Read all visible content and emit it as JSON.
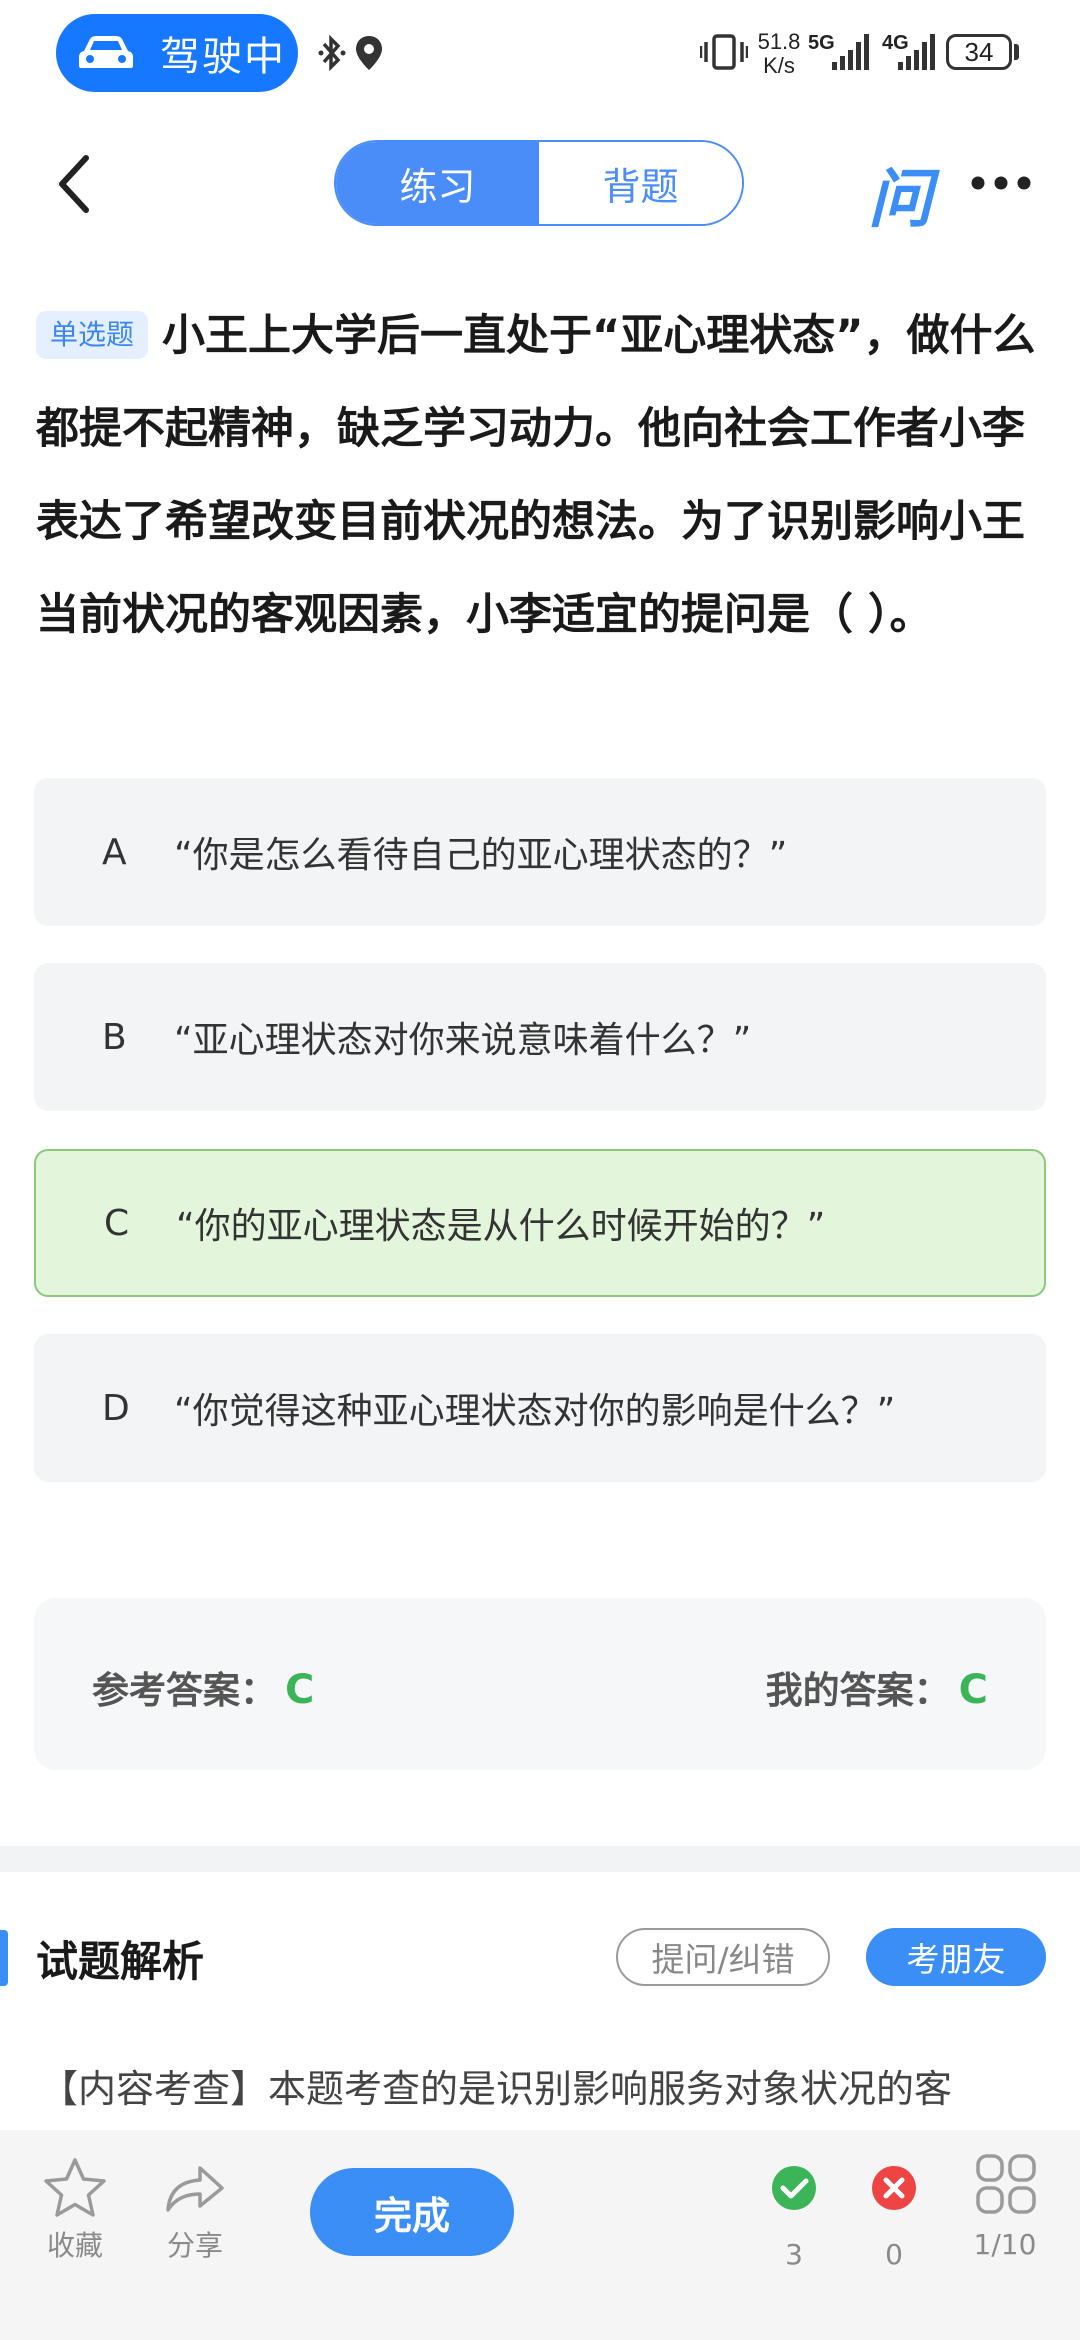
{
  "status_bar": {
    "drive_label": "驾驶中",
    "net_speed_value": "51.8",
    "net_speed_unit": "K/s",
    "sim1_label": "5G",
    "sim2_label": "4G",
    "battery": "34"
  },
  "nav": {
    "tabs": [
      {
        "label": "练习",
        "active": true
      },
      {
        "label": "背题",
        "active": false
      }
    ],
    "ask_logo": "问"
  },
  "question": {
    "type_tag": "单选题",
    "text": "小王上大学后一直处于“亚心理状态”，做什么都提不起精神，缺乏学习动力。他向社会工作者小李表达了希望改变目前状况的想法。为了识别影响小王当前状况的客观因素，小李适宜的提问是（ ）。"
  },
  "options": [
    {
      "letter": "A",
      "text": "“你是怎么看待自己的亚心理状态的？”",
      "state": "normal"
    },
    {
      "letter": "B",
      "text": "“亚心理状态对你来说意味着什么？”",
      "state": "normal"
    },
    {
      "letter": "C",
      "text": "“你的亚心理状态是从什么时候开始的？”",
      "state": "correct"
    },
    {
      "letter": "D",
      "text": "“你觉得这种亚心理状态对你的影响是什么？”",
      "state": "normal"
    }
  ],
  "answers": {
    "reference_label": "参考答案：",
    "reference_value": "C",
    "mine_label": "我的答案：",
    "mine_value": "C"
  },
  "analysis": {
    "title": "试题解析",
    "ask_btn": "提问/纠错",
    "friend_btn": "考朋友",
    "text": "【内容考查】本题考查的是识别影响服务对象状况的客"
  },
  "bottom_bar": {
    "favorite_label": "收藏",
    "share_label": "分享",
    "done_label": "完成",
    "correct_count": "3",
    "wrong_count": "0",
    "progress": "1/10"
  },
  "colors": {
    "accent": "#3a8ef6",
    "correct": "#3cb559",
    "wrong": "#ef4444"
  }
}
